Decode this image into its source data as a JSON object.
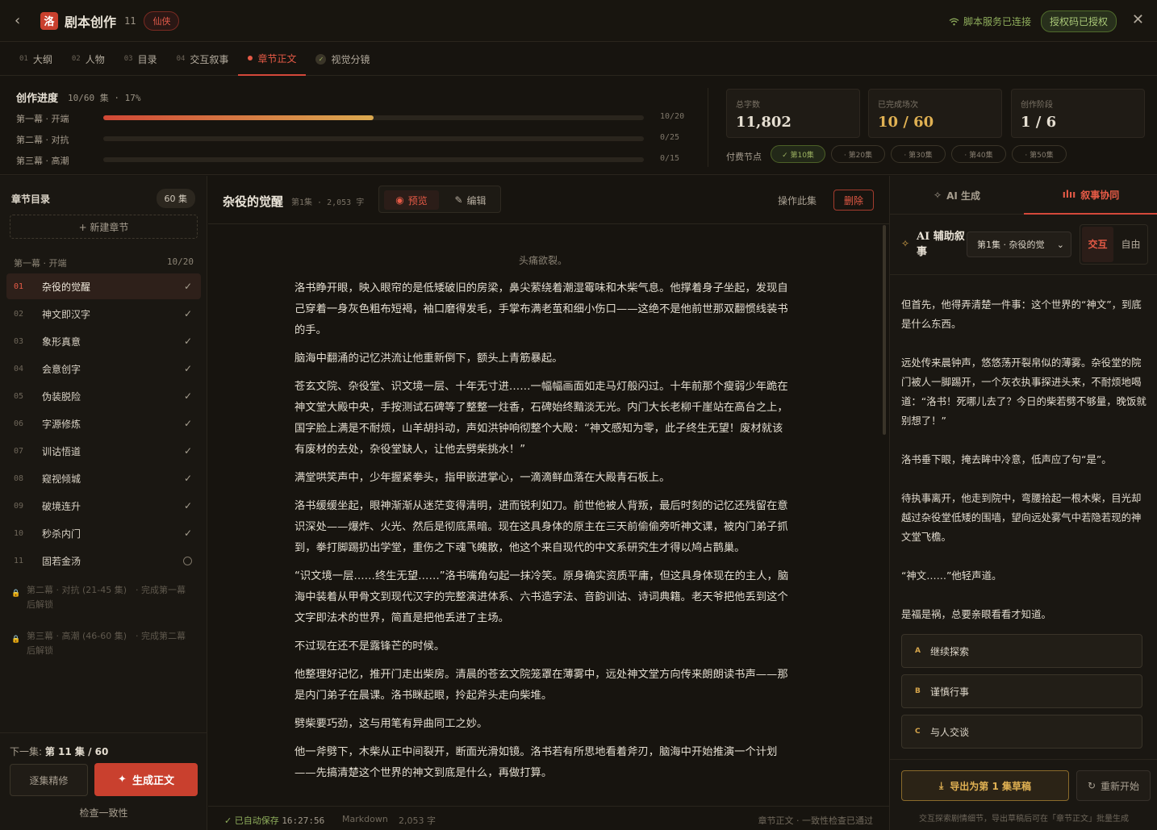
{
  "header": {
    "back_icon": "‹",
    "logo_char": "洛",
    "title": "剧本创作",
    "ep_count": "11",
    "genre": "仙侠",
    "connection": "脚本服务已连接",
    "license": "授权码已授权",
    "close_icon": "✕"
  },
  "tabs": [
    {
      "num": "01",
      "label": "大纲"
    },
    {
      "num": "02",
      "label": "人物"
    },
    {
      "num": "03",
      "label": "目录"
    },
    {
      "num": "04",
      "label": "交互叙事"
    },
    {
      "num": "",
      "label": "章节正文"
    },
    {
      "num": "",
      "label": "视觉分镜"
    }
  ],
  "progress": {
    "title": "创作进度",
    "summary": "10/60 集 · 17%",
    "acts": [
      {
        "label": "第一幕 · 开端",
        "count": "10/20",
        "fraction": 0.5
      },
      {
        "label": "第二幕 · 对抗",
        "count": "0/25",
        "fraction": 0
      },
      {
        "label": "第三幕 · 高潮",
        "count": "0/15",
        "fraction": 0
      }
    ],
    "stats": [
      {
        "label": "总字数",
        "value": "11,802"
      },
      {
        "label": "已完成场次",
        "value": "10 / 60"
      },
      {
        "label": "创作阶段",
        "value": "1 / 6"
      }
    ],
    "pay_label": "付费节点",
    "pay_nodes": [
      {
        "label": "✓ 第10集",
        "done": true
      },
      {
        "label": "· 第20集",
        "done": false
      },
      {
        "label": "· 第30集",
        "done": false
      },
      {
        "label": "· 第40集",
        "done": false
      },
      {
        "label": "· 第50集",
        "done": false
      }
    ]
  },
  "sidebar": {
    "title": "章节目录",
    "count": "60 集",
    "new_chapter": "+ 新建章节",
    "act1_label": "第一幕 · 开端",
    "act1_count": "10/20",
    "chapters": [
      {
        "no": "01",
        "name": "杂役的觉醒",
        "done": true
      },
      {
        "no": "02",
        "name": "神文即汉字",
        "done": true
      },
      {
        "no": "03",
        "name": "象形真意",
        "done": true
      },
      {
        "no": "04",
        "name": "会意创字",
        "done": true
      },
      {
        "no": "05",
        "name": "伪装脱险",
        "done": true
      },
      {
        "no": "06",
        "name": "字源修炼",
        "done": true
      },
      {
        "no": "07",
        "name": "训诂悟道",
        "done": true
      },
      {
        "no": "08",
        "name": "窥视倾城",
        "done": true
      },
      {
        "no": "09",
        "name": "破境连升",
        "done": true
      },
      {
        "no": "10",
        "name": "秒杀内门",
        "done": true
      },
      {
        "no": "11",
        "name": "固若金汤",
        "done": false
      }
    ],
    "locked": [
      "第二幕 · 对抗 (21-45 集)　· 完成第一幕后解锁",
      "第三幕 · 高潮 (46-60 集)　· 完成第二幕后解锁"
    ],
    "next_prefix": "下一集:",
    "next_value": "第 11 集 / 60",
    "refine": "逐集精修",
    "generate": "生成正文",
    "check": "检查一致性"
  },
  "editor": {
    "title": "杂役的觉醒",
    "meta": "第1集 · 2,053 字",
    "preview": "预览",
    "edit": "编辑",
    "ops": "操作此集",
    "delete": "删除",
    "epigraph": "头痛欲裂。",
    "paragraphs": [
      "洛书睁开眼，映入眼帘的是低矮破旧的房梁，鼻尖萦绕着潮湿霉味和木柴气息。他撑着身子坐起，发现自己穿着一身灰色粗布短褐，袖口磨得发毛，手掌布满老茧和细小伤口——这绝不是他前世那双翻惯线装书的手。",
      "脑海中翻涌的记忆洪流让他重新倒下，额头上青筋暴起。",
      "苍玄文院、杂役堂、识文境一层、十年无寸进……一幅幅画面如走马灯般闪过。十年前那个瘦弱少年跪在神文堂大殿中央，手按测试石碑等了整整一炷香，石碑始终黯淡无光。内门大长老柳千崖站在高台之上，国字脸上满是不耐烦，山羊胡抖动，声如洪钟响彻整个大殿：“神文感知为零，此子终生无望！废材就该有废材的去处，杂役堂缺人，让他去劈柴挑水！”",
      "满堂哄笑声中，少年握紧拳头，指甲嵌进掌心，一滴滴鲜血落在大殿青石板上。",
      "洛书缓缓坐起，眼神渐渐从迷茫变得清明，进而锐利如刀。前世他被人背叛，最后时刻的记忆还残留在意识深处——爆炸、火光、然后是彻底黑暗。现在这具身体的原主在三天前偷偷旁听神文课，被内门弟子抓到，拳打脚踢扔出学堂，重伤之下魂飞魄散，他这个来自现代的中文系研究生才得以鸠占鹊巢。",
      "“识文境一层……终生无望……”洛书嘴角勾起一抹冷笑。原身确实资质平庸，但这具身体现在的主人，脑海中装着从甲骨文到现代汉字的完整演进体系、六书造字法、音韵训诂、诗词典籍。老天爷把他丢到这个文字即法术的世界，简直是把他丢进了主场。",
      "不过现在还不是露锋芒的时候。",
      "他整理好记忆，推开门走出柴房。清晨的苍玄文院笼罩在薄雾中，远处神文堂方向传来朗朗读书声——那是内门弟子在晨课。洛书眯起眼，拎起斧头走向柴堆。",
      "劈柴要巧劲，这与用笔有异曲同工之妙。",
      "他一斧劈下，木柴从正中间裂开，断面光滑如镜。洛书若有所思地看着斧刃，脑海中开始推演一个计划——先搞清楚这个世界的神文到底是什么，再做打算。"
    ],
    "saved": "✓ 已自动保存",
    "saved_time": "16:27:56",
    "format": "Markdown",
    "words": "2,053 字",
    "footer_right": "章节正文 · 一致性检查已通过"
  },
  "right": {
    "tab_ai": "AI 生成",
    "tab_narr": "叙事协同",
    "ai_title": "AI 辅助叙事",
    "episode_select": "第1集 · 杂役的觉",
    "mode_interactive": "交互",
    "mode_free": "自由",
    "story": [
      "但首先，他得弄清楚一件事：这个世界的“神文”，到底是什么东西。",
      "远处传来晨钟声，悠悠荡开裂帛似的薄雾。杂役堂的院门被人一脚踢开，一个灰衣执事探进头来，不耐烦地喝道：“洛书！死哪儿去了？今日的柴若劈不够量，晚饭就别想了！”",
      "洛书垂下眼，掩去眸中冷意，低声应了句“是”。",
      "待执事离开，他走到院中，弯腰拾起一根木柴，目光却越过杂役堂低矮的围墙，望向远处雾气中若隐若现的神文堂飞檐。",
      "“神文……”他轻声道。",
      "是福是祸，总要亲眼看看才知道。"
    ],
    "options": [
      {
        "key": "A",
        "label": "继续探索"
      },
      {
        "key": "B",
        "label": "谨慎行事"
      },
      {
        "key": "C",
        "label": "与人交谈"
      }
    ],
    "export": "导出为第 1 集草稿",
    "restart": "重新开始",
    "note": "交互探索剧情细节，导出草稿后可在「章节正文」批量生成"
  },
  "colors": {
    "accent": "#d4483a",
    "success": "#8fae5c",
    "gold": "#d6a54b",
    "bg": "#17140f"
  }
}
